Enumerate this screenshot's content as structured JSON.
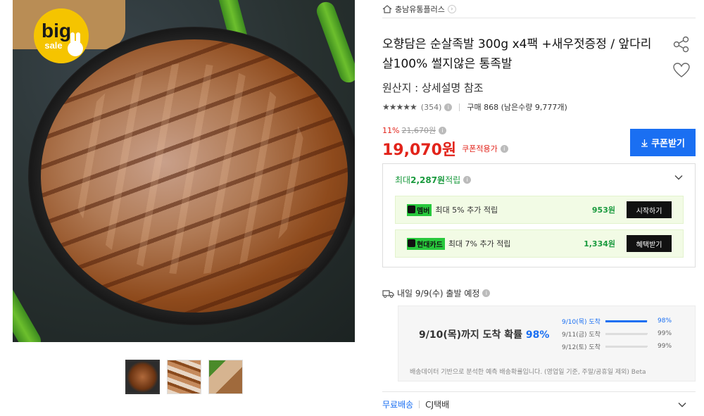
{
  "badge": {
    "line1": "big",
    "line2": "sale"
  },
  "seller": {
    "name": "충남유통플러스",
    "chevron": "›"
  },
  "product": {
    "title": "오향담은 순살족발 300g x4팩 +새우젓증정 / 앞다리살100% 썰지않은 통족발",
    "origin": "원산지 : 상세설명 참조"
  },
  "rating": {
    "stars": "★★★★★",
    "count": "(354)",
    "info": "i",
    "purchase": "구매 868 (남은수량 9,777개)"
  },
  "price": {
    "discount": "11%",
    "original": "21,670원",
    "sale": "19,070원",
    "coupon_note": "쿠폰적용가",
    "coupon_button": "쿠폰받기",
    "coupon_icon": "download-arrow"
  },
  "reward": {
    "head_prefix": "최대 ",
    "head_amount": "2,287원",
    "head_suffix": " 적립",
    "rows": [
      {
        "tag": "멤버",
        "text": "최대 5% 추가 적립",
        "amount": "953원",
        "button": "시작하기"
      },
      {
        "tag": "현대카드",
        "text": "최대 7% 추가 적립",
        "amount": "1,334원",
        "button": "혜택받기"
      }
    ]
  },
  "shipping": {
    "head": "내일 9/9(수) 출발 예정",
    "main_prefix": "9/10(목)까지 도착 확률 ",
    "main_pct": "98%",
    "probs": [
      {
        "label": "9/10(목) 도착",
        "value": "98%",
        "level": 0.98
      },
      {
        "label": "9/11(금) 도착",
        "value": "99%",
        "level": 0.99
      },
      {
        "label": "9/12(토) 도착",
        "value": "99%",
        "level": 0.99
      }
    ],
    "note": "배송데이터 기반으로 분석한 예측 배송확률입니다. (영업일 기준, 주말/공휴일 제외) Beta"
  },
  "delivery": {
    "free": "무료배송",
    "carrier": "CJ택배"
  },
  "colors": {
    "accent_blue": "#1a6ff2",
    "sale_red": "#e2231a",
    "reward_green": "#1a9a3e"
  }
}
